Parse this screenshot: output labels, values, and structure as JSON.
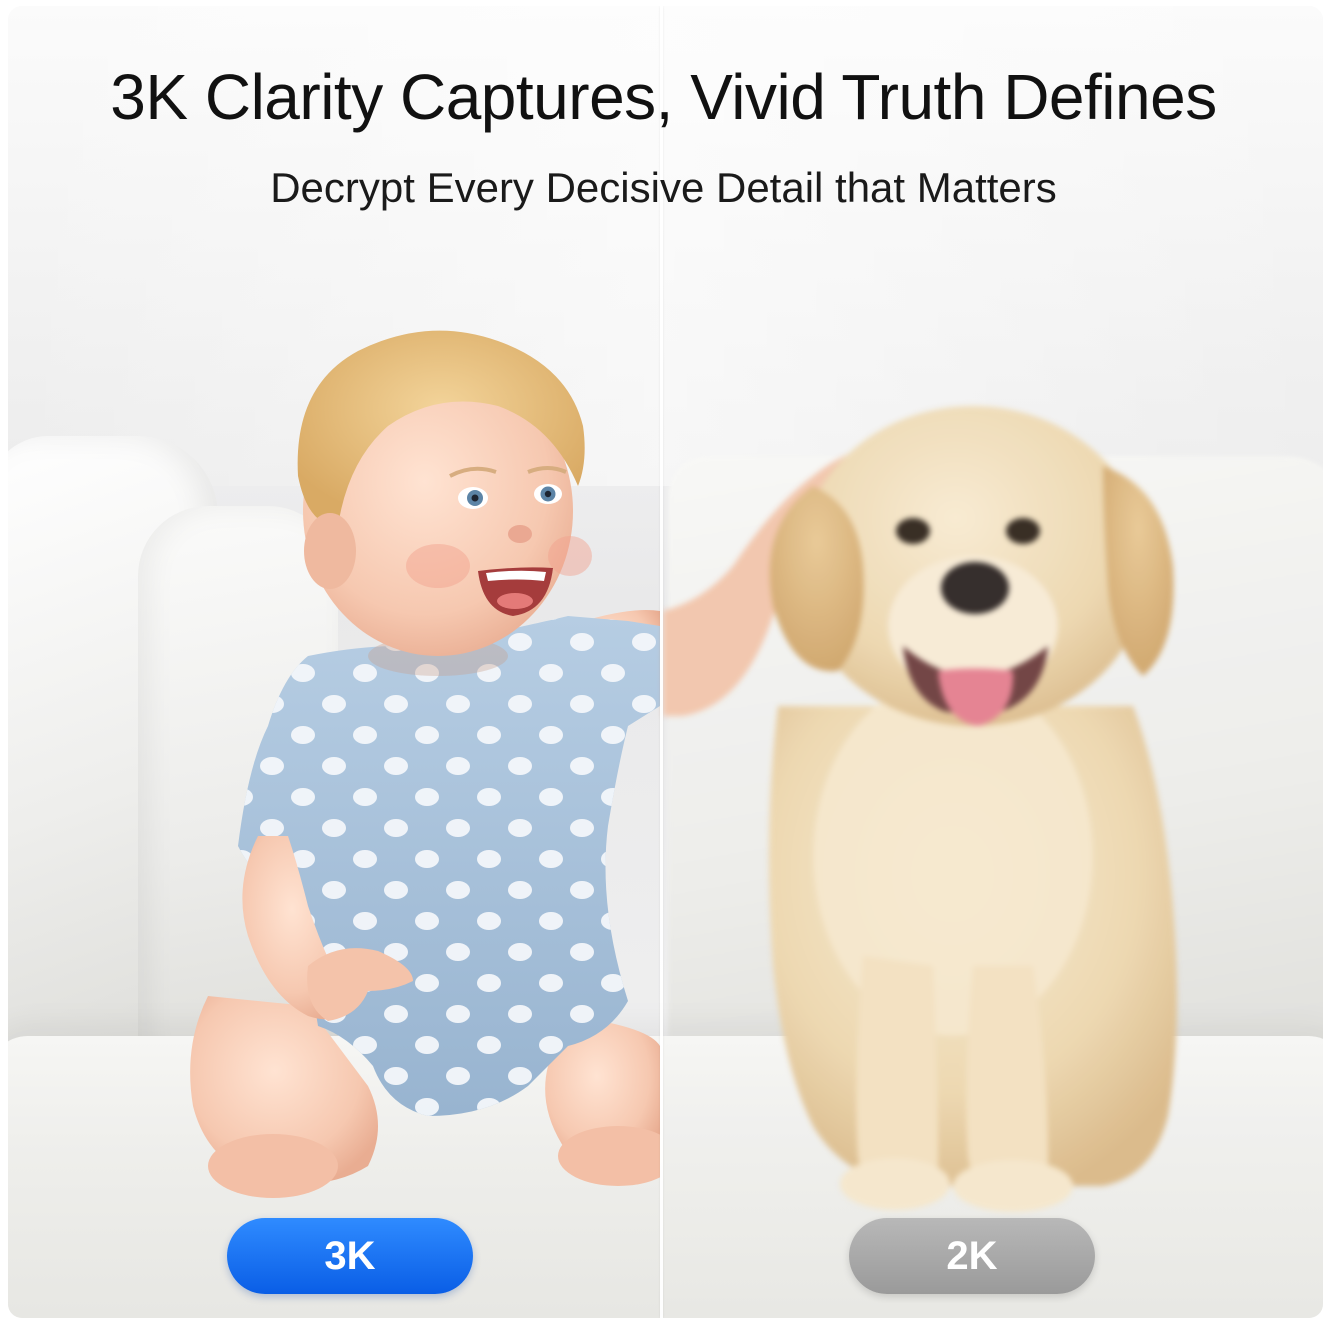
{
  "headline": "3K Clarity Captures, Vivid Truth Defines",
  "subheadline": "Decrypt Every Decisive Detail that Matters",
  "left_label": "3K",
  "right_label": "2K",
  "colors": {
    "badge_3k": "#0a6cf2",
    "badge_2k": "#a6a6a6",
    "romper": "#a9c2db",
    "dog_fur": "#ead2a6"
  },
  "scene": {
    "left_subject": "laughing-baby-in-polka-dot-romper",
    "right_subject": "labrador-puppy"
  }
}
